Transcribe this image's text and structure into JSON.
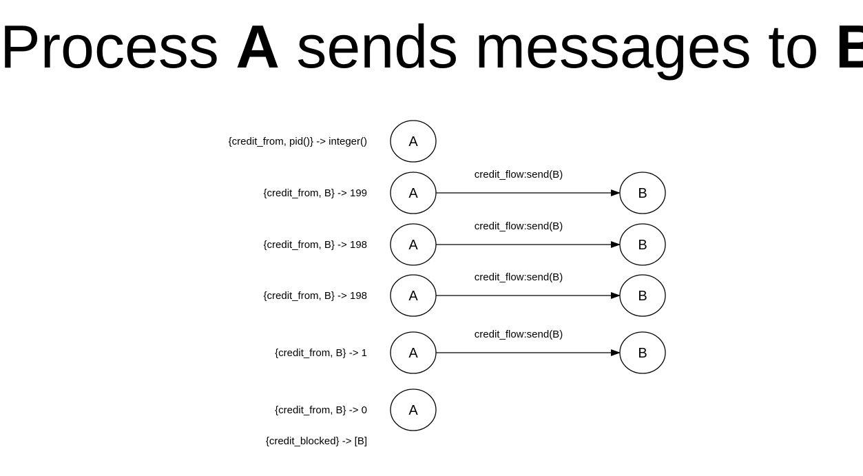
{
  "title": {
    "part1": "Process ",
    "a": "A",
    "part2": " sends messages to ",
    "b": "B"
  },
  "diagram": {
    "rows": [
      {
        "state": "{credit_from, pid()} -> integer()",
        "from": "A",
        "to": null,
        "message": null
      },
      {
        "state": "{credit_from, B} -> 199",
        "from": "A",
        "to": "B",
        "message": "credit_flow:send(B)"
      },
      {
        "state": "{credit_from, B} -> 198",
        "from": "A",
        "to": "B",
        "message": "credit_flow:send(B)"
      },
      {
        "state": "{credit_from, B} -> 198",
        "from": "A",
        "to": "B",
        "message": "credit_flow:send(B)"
      },
      {
        "state": "{credit_from, B} -> 1",
        "from": "A",
        "to": "B",
        "message": "credit_flow:send(B)"
      },
      {
        "state": "{credit_from, B} -> 0",
        "from": "A",
        "to": null,
        "message": null
      }
    ],
    "footer_state": "{credit_blocked} -> [B]"
  }
}
